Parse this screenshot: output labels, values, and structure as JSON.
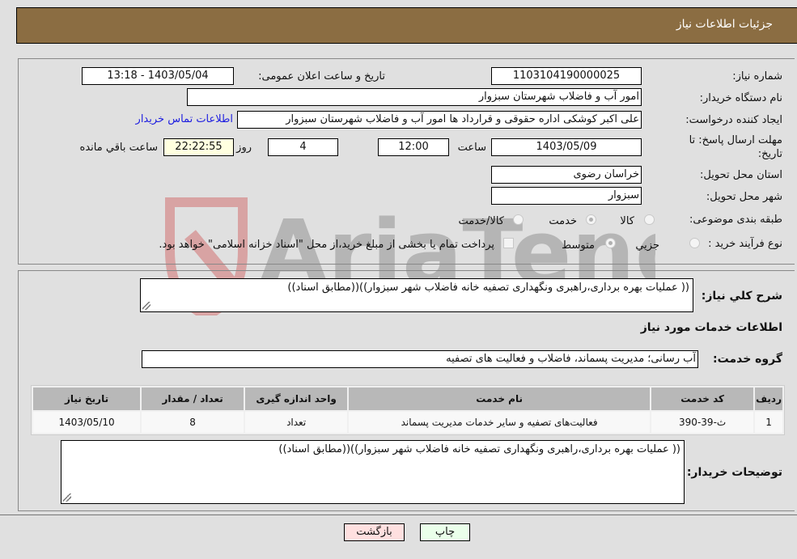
{
  "header": {
    "title": "جزئیات اطلاعات نیاز"
  },
  "fields": {
    "need_number": {
      "label": "شماره نیاز:",
      "value": "1103104190000025"
    },
    "announce_datetime": {
      "label": "تاریخ و ساعت اعلان عمومی:",
      "value": "1403/05/04 - 13:18"
    },
    "buyer_org": {
      "label": "نام دستگاه خریدار:",
      "value": "امور آب و فاضلاب شهرستان سبزوار"
    },
    "creator": {
      "label": "ایجاد کننده درخواست:",
      "value": "علی اکبر کوشکی اداره حقوقی و قرارداد ها امور آب و فاضلاب شهرستان سبزوار"
    },
    "buyer_contact_link": "اطلاعات تماس خریدار",
    "deadline": {
      "label": "مهلت ارسال پاسخ: تا تاریخ:",
      "date": "1403/05/09",
      "time_label": "ساعت",
      "time": "12:00",
      "days": "4",
      "days_label": "روز و",
      "remaining": "22:22:55",
      "remaining_label": "ساعت باقي مانده"
    },
    "province": {
      "label": "استان محل تحویل:",
      "value": "خراسان رضوی"
    },
    "city": {
      "label": "شهر محل تحویل:",
      "value": "سبزوار"
    },
    "category": {
      "label": "طبقه بندی موضوعی:",
      "options": [
        "کالا",
        "خدمت",
        "کالا/خدمت"
      ],
      "selected": "خدمت"
    },
    "purchase_type": {
      "label": "نوع فرآیند خرید :",
      "options": [
        "جزيي",
        "متوسط"
      ],
      "selected": "متوسط",
      "treasury_note": "پرداخت تمام یا بخشی از مبلغ خرید،از محل \"اسناد خزانه اسلامی\" خواهد بود."
    }
  },
  "description": {
    "label": "شرح كلي نياز:",
    "value": "(( عملیات بهره برداری،راهبری ونگهداری تصفیه خانه فاضلاب شهر سبزوار))((مطابق اسناد))"
  },
  "services_section": {
    "title": "اطلاعات خدمات مورد نياز",
    "group_label": "گروه خدمت:",
    "group_value": "آب رسانی؛ مدیریت پسماند، فاضلاب و فعالیت های تصفیه"
  },
  "table": {
    "headers": [
      "ردیف",
      "کد خدمت",
      "نام خدمت",
      "واحد اندازه گیری",
      "تعداد / مقدار",
      "تاریخ نیاز"
    ],
    "rows": [
      [
        "1",
        "ث-39-390",
        "فعالیت‌های تصفیه و سایر خدمات مدیریت پسماند",
        "تعداد",
        "8",
        "1403/05/10"
      ]
    ]
  },
  "buyer_notes": {
    "label": "توضیحات خریدار:",
    "value": "(( عملیات بهره برداری،راهبری ونگهداری تصفیه خانه فاضلاب شهر سبزوار))((مطابق اسناد))"
  },
  "buttons": {
    "print": "چاپ",
    "back": "بازگشت"
  },
  "colors": {
    "header_bg": "#8b6d42",
    "print_btn_bg": "#eaffea",
    "back_btn_bg": "#ffe0e0",
    "link": "#2020e0"
  }
}
